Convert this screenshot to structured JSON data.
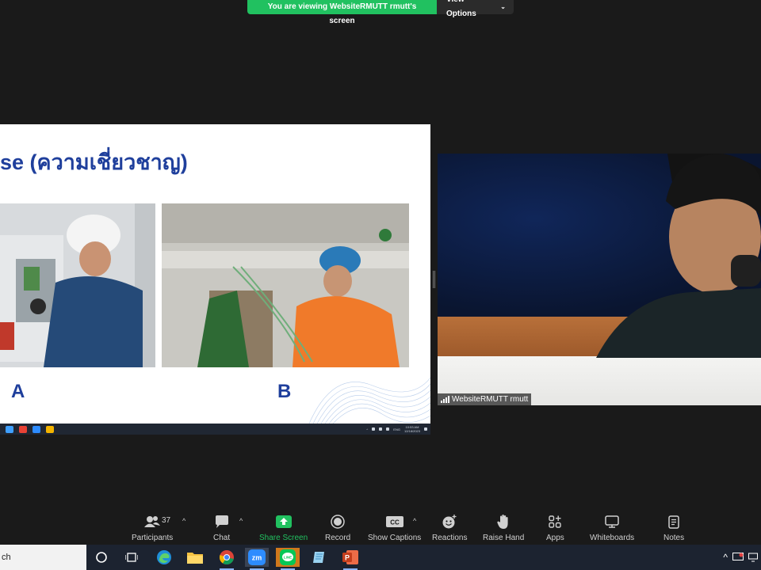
{
  "banner": {
    "viewing_text": "You are viewing WebsiteRMUTT rmutt's screen",
    "view_options_label": "View Options"
  },
  "slide": {
    "title": "se (ความเชี่ยวชาญ)",
    "label_a": "A",
    "label_b": "B",
    "clock_time": "10:53 AM",
    "clock_date": "12/18/2023",
    "lang": "ENG"
  },
  "video": {
    "participant_name": "WebsiteRMUTT rmutt"
  },
  "toolbar": {
    "participants_label": "Participants",
    "participants_count": "37",
    "chat_label": "Chat",
    "share_label": "Share Screen",
    "record_label": "Record",
    "captions_label": "Show Captions",
    "reactions_label": "Reactions",
    "raise_hand_label": "Raise Hand",
    "apps_label": "Apps",
    "whiteboards_label": "Whiteboards",
    "notes_label": "Notes"
  },
  "taskbar": {
    "search_text": "ch"
  },
  "colors": {
    "zoom_green": "#21c160",
    "slide_blue": "#1f3f9c",
    "toolbar_bg": "#1a1a1a",
    "taskbar_bg": "#1c2330"
  }
}
